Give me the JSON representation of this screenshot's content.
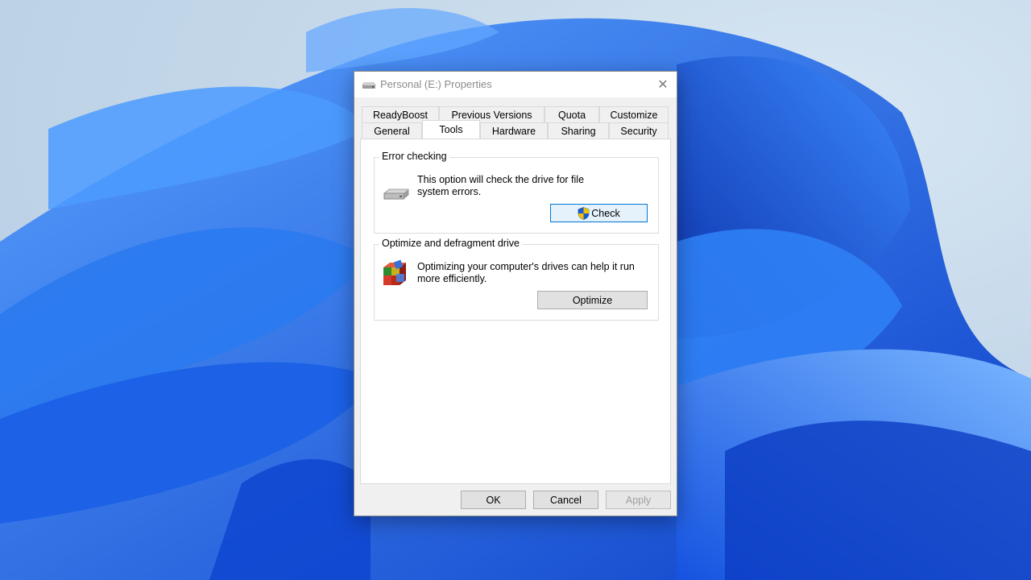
{
  "window": {
    "title": "Personal (E:) Properties",
    "close_label": "✕"
  },
  "tabs_row1": [
    {
      "label": "ReadyBoost"
    },
    {
      "label": "Previous Versions"
    },
    {
      "label": "Quota"
    },
    {
      "label": "Customize"
    }
  ],
  "tabs_row2": [
    {
      "label": "General"
    },
    {
      "label": "Tools",
      "selected": true
    },
    {
      "label": "Hardware"
    },
    {
      "label": "Sharing"
    },
    {
      "label": "Security"
    }
  ],
  "error_checking": {
    "title": "Error checking",
    "description_line1": "This option will check the drive for file",
    "description_line2": "system errors.",
    "button_label": "Check",
    "button_icon": "uac-shield-icon"
  },
  "optimize": {
    "title": "Optimize and defragment drive",
    "description_line1": "Optimizing your computer's drives can help it run",
    "description_line2": "more efficiently.",
    "button_label": "Optimize",
    "icon": "defrag-icon"
  },
  "footer": {
    "ok_label": "OK",
    "cancel_label": "Cancel",
    "apply_label": "Apply"
  },
  "colors": {
    "wallpaper_blue": "#1a5ee8",
    "focus_border": "#0078d7"
  }
}
